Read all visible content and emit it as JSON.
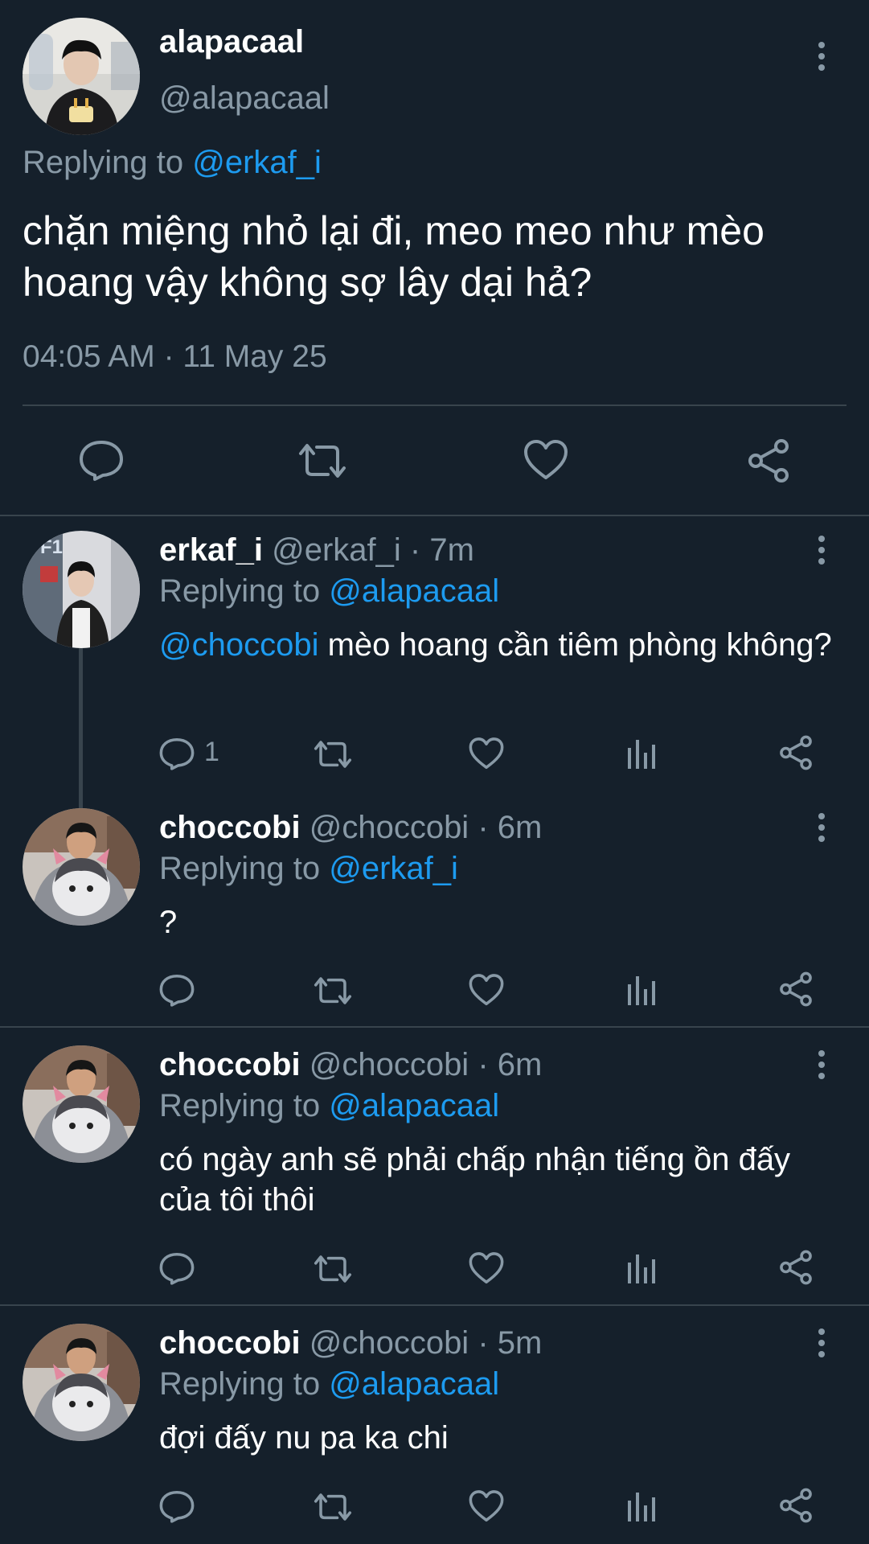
{
  "main_tweet": {
    "name": "alapacaal",
    "handle": "@alapacaal",
    "replying_prefix": "Replying to ",
    "replying_to": "@erkaf_i",
    "text": "chặn miệng nhỏ lại đi, meo meo như mèo hoang vậy không sợ lây dại hả?",
    "timestamp": "04:05 AM · 11 May 25",
    "actions": [
      "reply-icon",
      "retweet-icon",
      "like-icon",
      "share-icon"
    ]
  },
  "replies": [
    {
      "name": "erkaf_i",
      "handle": "@erkaf_i",
      "time": "· 7m",
      "replying_prefix": "Replying to ",
      "replying_to": "@alapacaal",
      "mention": "@choccobi",
      "text": " mèo hoang cần tiêm phòng không?",
      "reply_count": "1"
    },
    {
      "name": "choccobi",
      "handle": "@choccobi",
      "time": "· 6m",
      "replying_prefix": "Replying to ",
      "replying_to": "@erkaf_i",
      "text": "?"
    },
    {
      "name": "choccobi",
      "handle": "@choccobi",
      "time": "· 6m",
      "replying_prefix": "Replying to ",
      "replying_to": "@alapacaal",
      "text": "có ngày anh sẽ phải chấp nhận tiếng ồn đấy của tôi thôi"
    },
    {
      "name": "choccobi",
      "handle": "@choccobi",
      "time": "· 5m",
      "replying_prefix": "Replying to ",
      "replying_to": "@alapacaal",
      "text": "đợi đấy nu pa ka chi"
    }
  ],
  "colors": {
    "background": "#15202b",
    "text": "#ffffff",
    "muted": "#8899a6",
    "link": "#1d9bf0",
    "divider": "#38444d"
  }
}
